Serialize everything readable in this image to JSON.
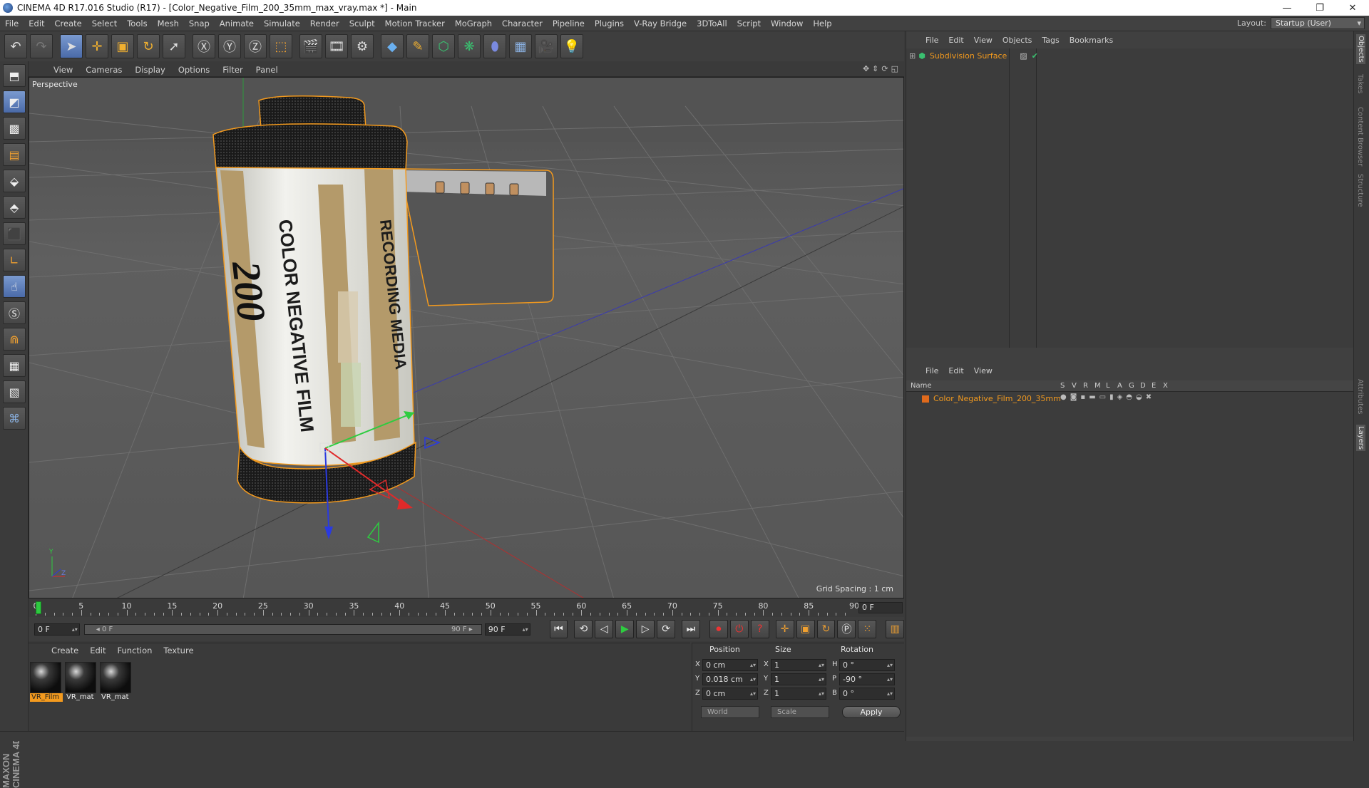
{
  "window": {
    "title": "CINEMA 4D R17.016 Studio (R17) - [Color_Negative_Film_200_35mm_max_vray.max *] - Main",
    "minimize": "—",
    "maximize": "❐",
    "close": "✕"
  },
  "menubar": {
    "items": [
      "File",
      "Edit",
      "Create",
      "Select",
      "Tools",
      "Mesh",
      "Snap",
      "Animate",
      "Simulate",
      "Render",
      "Sculpt",
      "Motion Tracker",
      "MoGraph",
      "Character",
      "Pipeline",
      "Plugins",
      "V-Ray Bridge",
      "3DToAll",
      "Script",
      "Window",
      "Help"
    ],
    "layout_label": "Layout:",
    "layout_value": "Startup (User)"
  },
  "viewport": {
    "menu": [
      "View",
      "Cameras",
      "Display",
      "Options",
      "Filter",
      "Panel"
    ],
    "label": "Perspective",
    "grid_spacing": "Grid Spacing : 1 cm",
    "label_text": {
      "brand": "COLOR NEGATIVE FILM",
      "side": "RECORDING MEDIA",
      "number": "200"
    }
  },
  "timeline": {
    "ticks": [
      "0",
      "5",
      "10",
      "15",
      "20",
      "25",
      "30",
      "35",
      "40",
      "45",
      "50",
      "55",
      "60",
      "65",
      "70",
      "75",
      "80",
      "85",
      "90"
    ],
    "end_frame": "0 F"
  },
  "transport": {
    "current": "0 F",
    "range_start": "◂ 0 F",
    "range_end": "90 F ▸",
    "max": "90 F"
  },
  "material_manager": {
    "menu": [
      "Create",
      "Edit",
      "Function",
      "Texture"
    ],
    "materials": [
      "VR_Film",
      "VR_mat",
      "VR_mat"
    ]
  },
  "coordinates": {
    "headers": {
      "position": "Position",
      "size": "Size",
      "rotation": "Rotation"
    },
    "rows": [
      {
        "axis": "X",
        "pos": "0 cm",
        "saxis": "X",
        "size": "1",
        "raxis": "H",
        "rot": "0 °"
      },
      {
        "axis": "Y",
        "pos": "0.018 cm",
        "saxis": "Y",
        "size": "1",
        "raxis": "P",
        "rot": "-90 °"
      },
      {
        "axis": "Z",
        "pos": "0 cm",
        "saxis": "Z",
        "size": "1",
        "raxis": "B",
        "rot": "0 °"
      }
    ],
    "space": "World",
    "mode": "Scale",
    "apply": "Apply"
  },
  "object_manager": {
    "menu": [
      "File",
      "Edit",
      "View",
      "Objects",
      "Tags",
      "Bookmarks"
    ],
    "objects": [
      {
        "name": "Subdivision Surface"
      }
    ]
  },
  "layer_manager": {
    "menu": [
      "File",
      "Edit",
      "View"
    ],
    "columns": [
      "Name",
      "S",
      "V",
      "R",
      "M",
      "L",
      "A",
      "G",
      "D",
      "E",
      "X"
    ],
    "layers": [
      {
        "name": "Color_Negative_Film_200_35mm"
      }
    ]
  },
  "side_tabs": [
    "Objects",
    "Takes",
    "Content Browser",
    "Structure",
    "Attributes",
    "Layers"
  ],
  "maxon_logo": "MAXON CINEMA 4D",
  "colors": {
    "accent": "#f39a1e",
    "selection": "#5a7ab8",
    "playhead": "#2ec840"
  }
}
